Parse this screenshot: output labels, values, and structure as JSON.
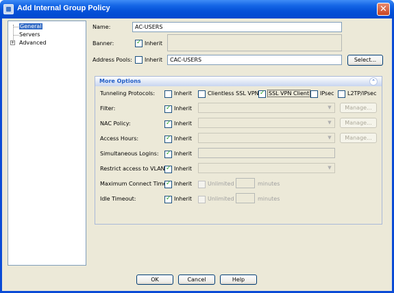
{
  "window": {
    "title": "Add Internal Group Policy",
    "close_glyph": "✕"
  },
  "tree": {
    "items": [
      "General",
      "Servers",
      "Advanced"
    ],
    "expander_glyph": "+"
  },
  "name": {
    "label": "Name:",
    "value": "AC-USERS"
  },
  "banner": {
    "label": "Banner:",
    "inherit_label": "Inherit",
    "inherit_checked": true
  },
  "address_pools": {
    "label": "Address Pools:",
    "inherit_label": "Inherit",
    "inherit_checked": false,
    "value": "CAC-USERS",
    "select_label": "Select..."
  },
  "more_options": {
    "title": "More Options",
    "collapse_glyph": "⌃",
    "tunneling": {
      "label": "Tunneling Protocols:",
      "inherit_label": "Inherit",
      "options": [
        "Clientless SSL VPN",
        "SSL VPN Client",
        "IPsec",
        "L2TP/IPsec"
      ],
      "checked": [
        false,
        true,
        false,
        false
      ]
    },
    "filter": {
      "label": "Filter:",
      "inherit_label": "Inherit",
      "manage_label": "Manage..."
    },
    "nac_policy": {
      "label": "NAC Policy:",
      "inherit_label": "Inherit",
      "manage_label": "Manage..."
    },
    "access_hours": {
      "label": "Access Hours:",
      "inherit_label": "Inherit",
      "manage_label": "Manage..."
    },
    "simultaneous_logins": {
      "label": "Simultaneous Logins:",
      "inherit_label": "Inherit"
    },
    "restrict_vlan": {
      "label": "Restrict access to VLAN:",
      "inherit_label": "Inherit"
    },
    "max_connect_time": {
      "label": "Maximum Connect Time:",
      "inherit_label": "Inherit",
      "unlimited_label": "Unlimited",
      "unit": "minutes"
    },
    "idle_timeout": {
      "label": "Idle Timeout:",
      "inherit_label": "Inherit",
      "unlimited_label": "Unlimited",
      "unit": "minutes"
    }
  },
  "footer": {
    "ok_label": "OK",
    "cancel_label": "Cancel",
    "help_label": "Help"
  },
  "colors": {
    "title_bar": "#0551d8",
    "selection": "#316ac5",
    "panel_header_text": "#215dc6",
    "check": "#21a121"
  }
}
